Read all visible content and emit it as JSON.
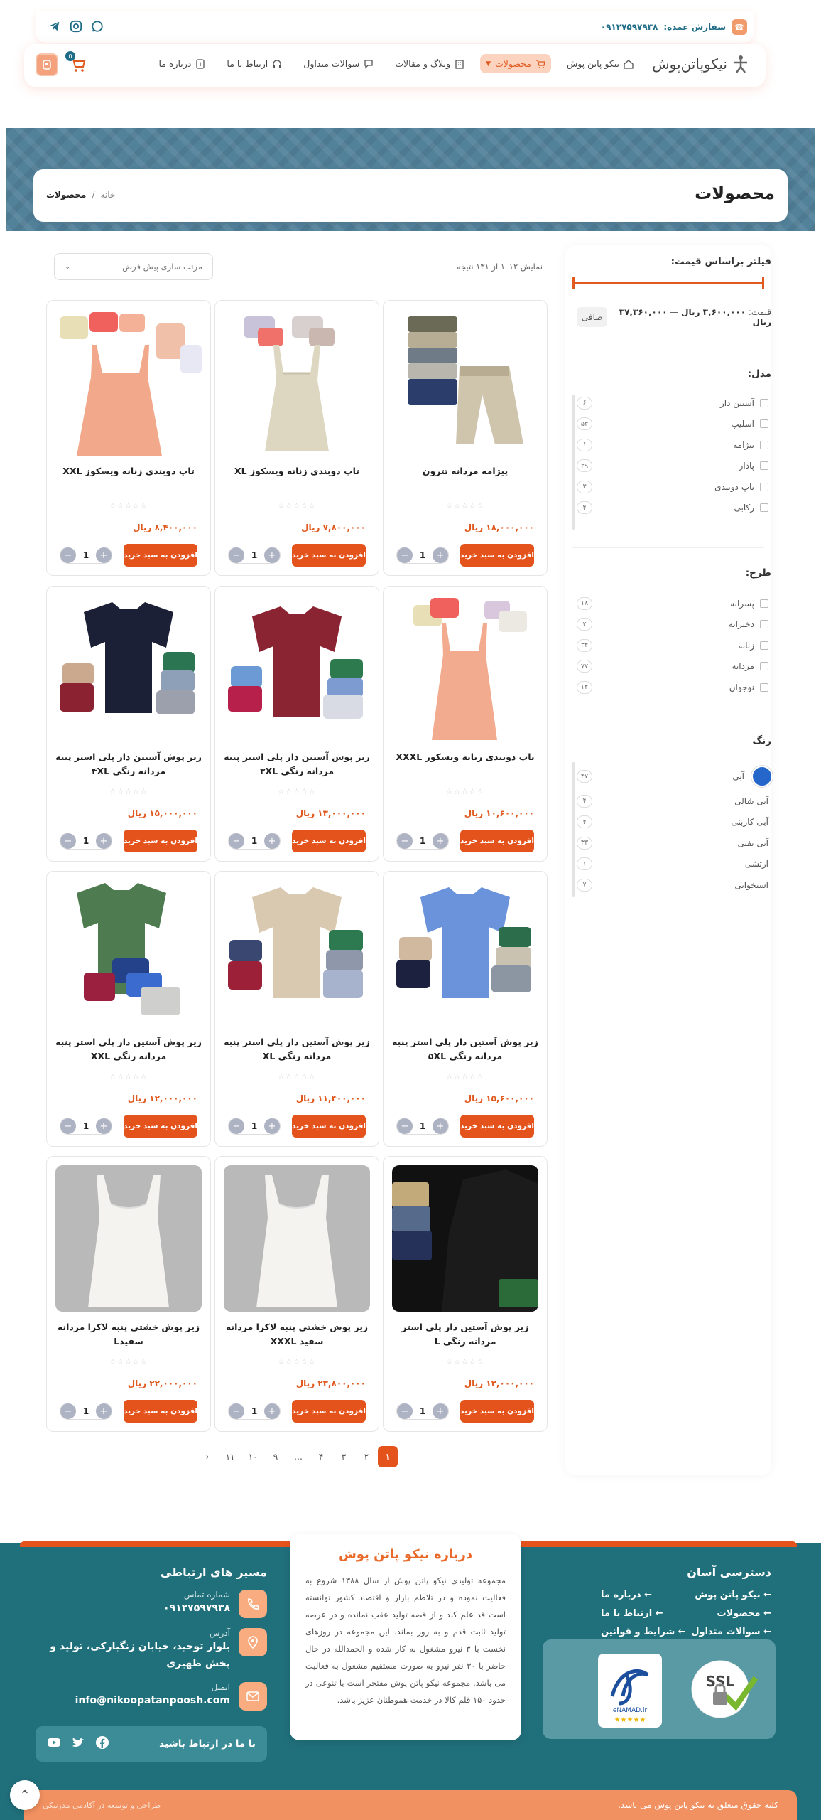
{
  "topbar": {
    "order_label": "سفارش عمده:",
    "order_phone": "۰۹۱۲۷۵۹۷۹۳۸"
  },
  "header": {
    "brand": "نیکوپاتن‌پوش",
    "menu": [
      {
        "label": "نیکو پاتن پوش",
        "icon": "home-icon"
      },
      {
        "label": "محصولات",
        "icon": "cart-icon",
        "active": true
      },
      {
        "label": "وبلاگ و مقالات",
        "icon": "building-icon"
      },
      {
        "label": "سوالات متداول",
        "icon": "chat-icon"
      },
      {
        "label": "ارتباط با ما",
        "icon": "headset-icon"
      },
      {
        "label": "درباره ما",
        "icon": "info-icon"
      }
    ],
    "cart_count": "0"
  },
  "hero": {
    "title": "محصولات",
    "breadcrumb_home": "خانه",
    "breadcrumb_sep": "/",
    "breadcrumb_current": "محصولات"
  },
  "filters": {
    "price_title": "فیلتر براساس قیمت:",
    "price_label": "قیمت:",
    "price_min": "۳,۶۰۰,۰۰۰ ریال",
    "price_dash": "—",
    "price_max": "۳۷,۳۶۰,۰۰۰ ریال",
    "clear": "صافی",
    "model_title": "مدل:",
    "models": [
      {
        "label": "آستین دار",
        "count": "۶"
      },
      {
        "label": "اسلیپ",
        "count": "۵۳"
      },
      {
        "label": "بیژامه",
        "count": "۱"
      },
      {
        "label": "پادار",
        "count": "۲۹"
      },
      {
        "label": "تاپ دوبندی",
        "count": "۳"
      },
      {
        "label": "رکابی",
        "count": "۴"
      }
    ],
    "design_title": "طرح:",
    "designs": [
      {
        "label": "پسرانه",
        "count": "۱۸"
      },
      {
        "label": "دخترانه",
        "count": "۲"
      },
      {
        "label": "زنانه",
        "count": "۳۴"
      },
      {
        "label": "مردانه",
        "count": "۷۷"
      },
      {
        "label": "نوجوان",
        "count": "۱۴"
      }
    ],
    "color_title": "رنگ",
    "colors": [
      {
        "label": "آبی",
        "count": "۴۷",
        "hex": "#2466c9"
      },
      {
        "label": "آبی شالی",
        "count": "۴"
      },
      {
        "label": "آبی کاربنی",
        "count": "۴"
      },
      {
        "label": "آبی نفتی",
        "count": "۳۳"
      },
      {
        "label": "ارتشی",
        "count": "۱"
      },
      {
        "label": "استخوانی",
        "count": "۷"
      }
    ]
  },
  "toolbar": {
    "result": "نمایش ۱۲–۱ از ۱۳۱ نتیجه",
    "sort": "مرتب سازی پیش فرض"
  },
  "products": [
    {
      "name": "پیژامه مردانه تترون",
      "price": "۱۸,۰۰۰,۰۰۰ ریال",
      "img": "pajama"
    },
    {
      "name": "تاپ دوبندی زنانه ویسکوز XL",
      "price": "۷,۸۰۰,۰۰۰ ریال",
      "img": "tank-beige"
    },
    {
      "name": "تاپ دوبندی زنانه ویسکوز XXL",
      "price": "۸,۴۰۰,۰۰۰ ریال",
      "img": "tank-peach"
    },
    {
      "name": "تاپ دوبندی زنانه ویسکوز XXXL",
      "price": "۱۰,۶۰۰,۰۰۰ ریال",
      "img": "tank-peach-small"
    },
    {
      "name": "زیر پوش آستین دار پلی استر پنبه مردانه رنگی ۳XL",
      "price": "۱۳,۰۰۰,۰۰۰ ریال",
      "img": "tee-maroon"
    },
    {
      "name": "زیر پوش آستین دار پلی استر پنبه مردانه رنگی ۴XL",
      "price": "۱۵,۰۰۰,۰۰۰ ریال",
      "img": "tee-navy"
    },
    {
      "name": "زیر پوش آستین دار پلی استر پنبه مردانه رنگی ۵XL",
      "price": "۱۵,۶۰۰,۰۰۰ ریال",
      "img": "tee-blue"
    },
    {
      "name": "زیر پوش آستین دار پلی استر پنبه مردانه رنگی XL",
      "price": "۱۱,۴۰۰,۰۰۰ ریال",
      "img": "tee-beige"
    },
    {
      "name": "زیر پوش آستین دار پلی استر پنبه مردانه رنگی XXL",
      "price": "۱۲,۰۰۰,۰۰۰ ریال",
      "img": "tee-green"
    },
    {
      "name": "زیر پوش آستین دار پلی استر مردانه رنگی L",
      "price": "۱۲,۰۰۰,۰۰۰ ریال",
      "img": "tee-black"
    },
    {
      "name": "زیر پوش خشتی پنبه لاکرا مردانه سفید XXXL",
      "price": "۲۳,۸۰۰,۰۰۰ ریال",
      "img": "vest-white"
    },
    {
      "name": "زیر پوش خشتی پنبه لاکرا مردانه سفیدL",
      "price": "۲۲,۰۰۰,۰۰۰ ریال",
      "img": "vest-white"
    }
  ],
  "product_ui": {
    "add_label": "افزودن به سبد خرید",
    "qty": "1",
    "stars": "☆☆☆☆☆"
  },
  "pagination": [
    "۱",
    "۲",
    "۳",
    "۴",
    "…",
    "۹",
    "۱۰",
    "۱۱"
  ],
  "footer": {
    "quick_title": "دسترسی آسان",
    "quick_links": [
      [
        "نیکو پاتن پوش",
        "درباره ما"
      ],
      [
        "محصولات",
        "ارتباط با ما"
      ],
      [
        "سوالات متداول",
        "شرایط و قوانین"
      ]
    ],
    "about_title": "درباره نیکو پاتن پوش",
    "about_text": "مجموعه تولیدی نیکو پاتن پوش از سال ۱۳۸۸ شروع به فعالیت نموده و در تلاطم بازار و اقتصاد کشور توانسته است قد علم کند و از قصه تولید عقب نمانده و در عرصه تولید ثابت قدم و به روز بماند. این مجموعه در روزهای نخست با ۳ نیرو مشغول به کار شده و الحمدالله در حال حاضر با ۳۰ نفر نیرو به صورت مستقیم مشغول به فعالیت می باشد. مجموعه نیکو پاتن پوش مفتخر است با تنوعی در حدود ۱۵۰ قلم کالا در خدمت هموطنان عزیز باشد.",
    "contact_title": "مسیر های ارتباطی",
    "phone_label": "شماره تماس",
    "phone": "۰۹۱۲۷۵۹۷۹۳۸",
    "address_label": "آدرس",
    "address": "بلوار توحید، خیابان زنگبارکی، تولید و پخش ظهیری",
    "email_label": "ایمیل",
    "email": "info@nikoopatanpoosh.com",
    "social_title": "با ما در ارتباط باشید",
    "copyright": "کلیه حقوق متعلق به نیکو پاتن پوش می باشد.",
    "dev_credit": "طراحی و توسعه در آکادمی مدرنیکی"
  }
}
